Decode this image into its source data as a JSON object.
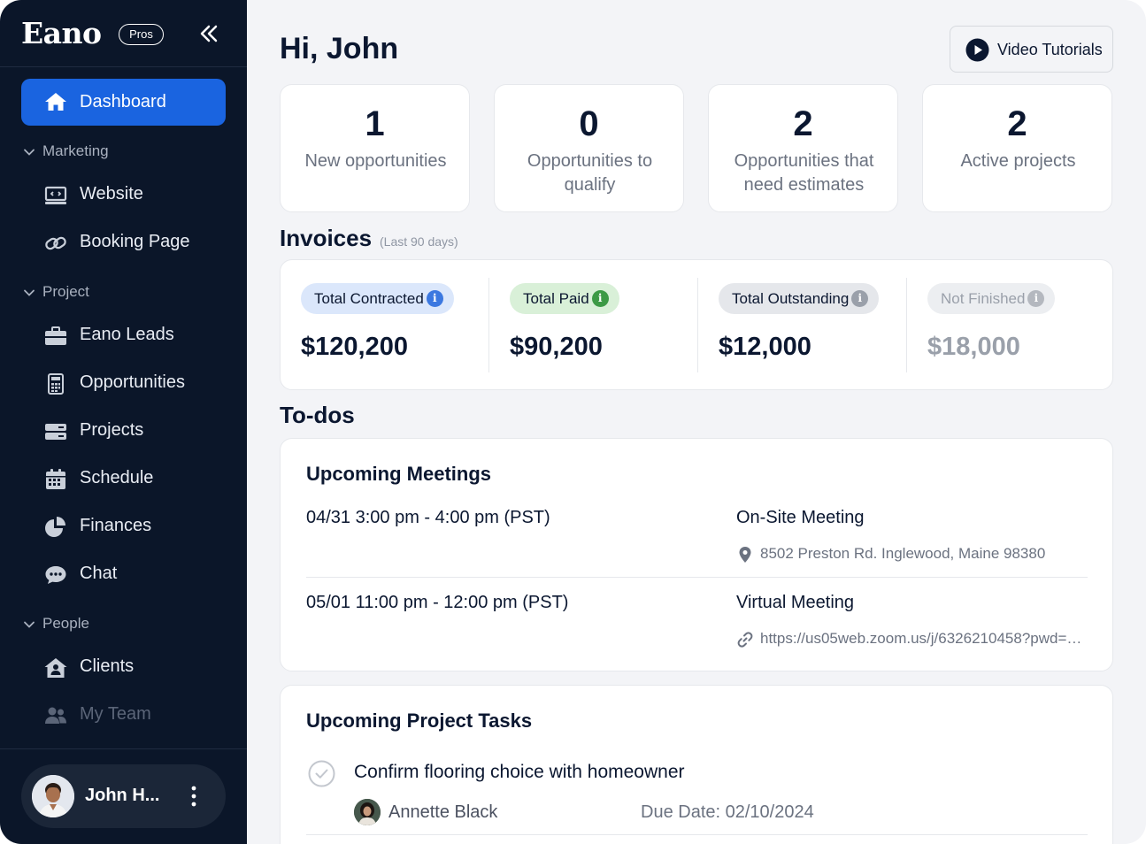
{
  "brand": {
    "logo": "Eano",
    "badge": "Pros"
  },
  "sidebar": {
    "active": {
      "label": "Dashboard",
      "icon": "home-icon"
    },
    "sections": [
      {
        "label": "Marketing",
        "items": [
          {
            "label": "Website",
            "icon": "monitor-icon"
          },
          {
            "label": "Booking Page",
            "icon": "link-icon"
          }
        ]
      },
      {
        "label": "Project",
        "items": [
          {
            "label": "Eano Leads",
            "icon": "briefcase-icon"
          },
          {
            "label": "Opportunities",
            "icon": "calculator-icon"
          },
          {
            "label": "Projects",
            "icon": "stack-icon"
          },
          {
            "label": "Schedule",
            "icon": "calendar-icon"
          },
          {
            "label": "Finances",
            "icon": "pie-chart-icon"
          },
          {
            "label": "Chat",
            "icon": "chat-icon"
          }
        ]
      },
      {
        "label": "People",
        "items": [
          {
            "label": "Clients",
            "icon": "house-user-icon"
          },
          {
            "label": "My Team",
            "icon": "team-icon"
          }
        ]
      }
    ],
    "user": {
      "name": "John H..."
    }
  },
  "header": {
    "greeting": "Hi, John",
    "video_button": "Video Tutorials"
  },
  "stats": [
    {
      "value": "1",
      "label": "New opportunities"
    },
    {
      "value": "0",
      "label": "Opportunities to qualify"
    },
    {
      "value": "2",
      "label": "Opportunities that need estimates"
    },
    {
      "value": "2",
      "label": "Active projects"
    }
  ],
  "invoices": {
    "title": "Invoices",
    "subtitle": "(Last 90 days)",
    "items": [
      {
        "label": "Total Contracted",
        "value": "$120,200",
        "pill_bg": "#dbe7fb",
        "info_color": "#3b78e0"
      },
      {
        "label": "Total Paid",
        "value": "$90,200",
        "pill_bg": "#d9f0d8",
        "info_color": "#3c9a45"
      },
      {
        "label": "Total Outstanding",
        "value": "$12,000",
        "pill_bg": "#e5e7eb",
        "info_color": "#9aa0aa"
      },
      {
        "label": "Not Finished",
        "value": "$18,000",
        "pill_bg": "#eceef1",
        "info_color": "#b4b8bf"
      }
    ]
  },
  "todos": {
    "title": "To-dos",
    "meetings": {
      "title": "Upcoming Meetings",
      "items": [
        {
          "when": "04/31  3:00 pm - 4:00 pm (PST)",
          "type": "On-Site Meeting",
          "location": "8502 Preston Rd. Inglewood, Maine 98380",
          "loc_icon": "map-pin-icon"
        },
        {
          "when": "05/01  11:00 pm - 12:00 pm (PST)",
          "type": "Virtual Meeting",
          "location": "https://us05web.zoom.us/j/6326210458?pwd=…",
          "loc_icon": "link-icon"
        }
      ]
    },
    "tasks": {
      "title": "Upcoming Project Tasks",
      "items": [
        {
          "title": "Confirm flooring choice with homeowner",
          "assignee": "Annette Black",
          "due": "Due Date: 02/10/2024"
        }
      ]
    }
  },
  "colors": {
    "sidebar_bg": "#0b1629",
    "accent": "#1a64e0",
    "page_bg": "#f3f4f7"
  }
}
